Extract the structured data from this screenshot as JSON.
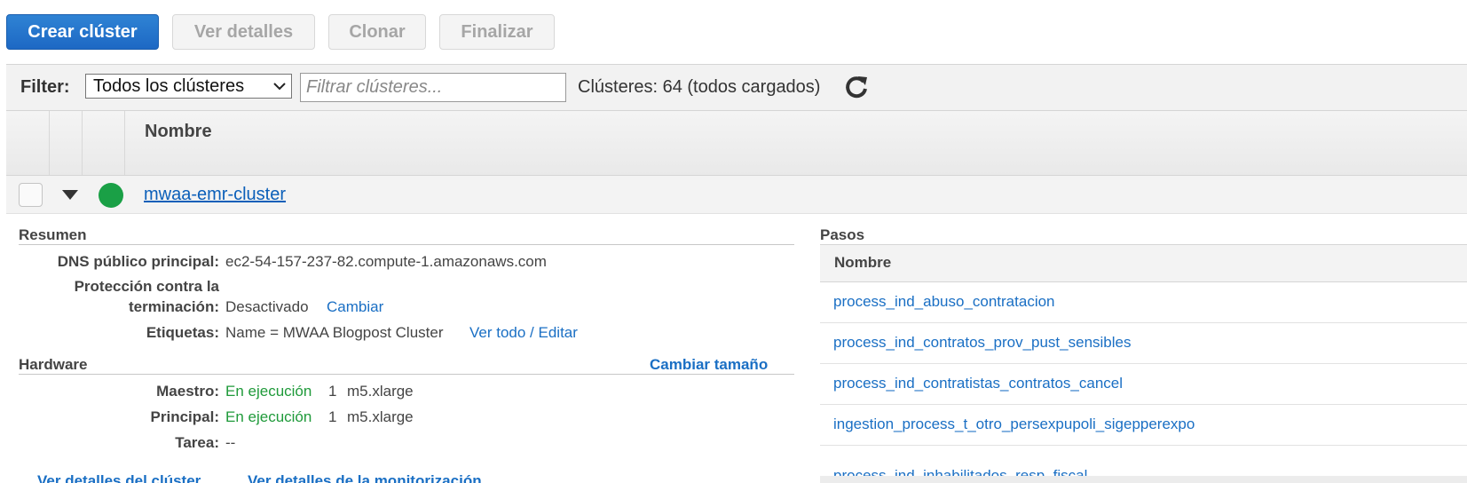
{
  "toolbar": {
    "create_label": "Crear clúster",
    "details_label": "Ver detalles",
    "clone_label": "Clonar",
    "finish_label": "Finalizar"
  },
  "filter": {
    "label": "Filter:",
    "selected_option": "Todos los clústeres",
    "search_placeholder": "Filtrar clústeres...",
    "count_text": "Clústeres: 64 (todos cargados)"
  },
  "table": {
    "header_name": "Nombre"
  },
  "cluster": {
    "name": "mwaa-emr-cluster",
    "status_color": "#1aa046"
  },
  "summary": {
    "title": "Resumen",
    "dns_label": "DNS público principal:",
    "dns_value": "ec2-54-157-237-82.compute-1.amazonaws.com",
    "protection_label_line1": "Protección contra la",
    "protection_label_line2": "terminación:",
    "protection_value": "Desactivado",
    "protection_action": "Cambiar",
    "tags_label": "Etiquetas:",
    "tags_value": "Name = MWAA Blogpost Cluster",
    "tags_action": "Ver todo / Editar"
  },
  "hardware": {
    "title": "Hardware",
    "resize_link": "Cambiar tamaño",
    "master_label": "Maestro:",
    "master_status": "En ejecución",
    "master_count": "1",
    "master_type": "m5.xlarge",
    "core_label": "Principal:",
    "core_status": "En ejecución",
    "core_count": "1",
    "core_type": "m5.xlarge",
    "task_label": "Tarea:",
    "task_value": "--"
  },
  "links": {
    "cluster_details": "Ver detalles del clúster",
    "monitoring_details": "Ver detalles de la monitorización"
  },
  "steps": {
    "title": "Pasos",
    "header_name": "Nombre",
    "items": [
      "process_ind_abuso_contratacion",
      "process_ind_contratos_prov_pust_sensibles",
      "process_ind_contratistas_contratos_cancel",
      "ingestion_process_t_otro_persexpupoli_sigepperexpo",
      "process_ind_inhabilitados_resp_fiscal"
    ]
  },
  "colors": {
    "primary_button": "#1d68c4",
    "link": "#1a6fc4",
    "running": "#1f9a3a"
  }
}
